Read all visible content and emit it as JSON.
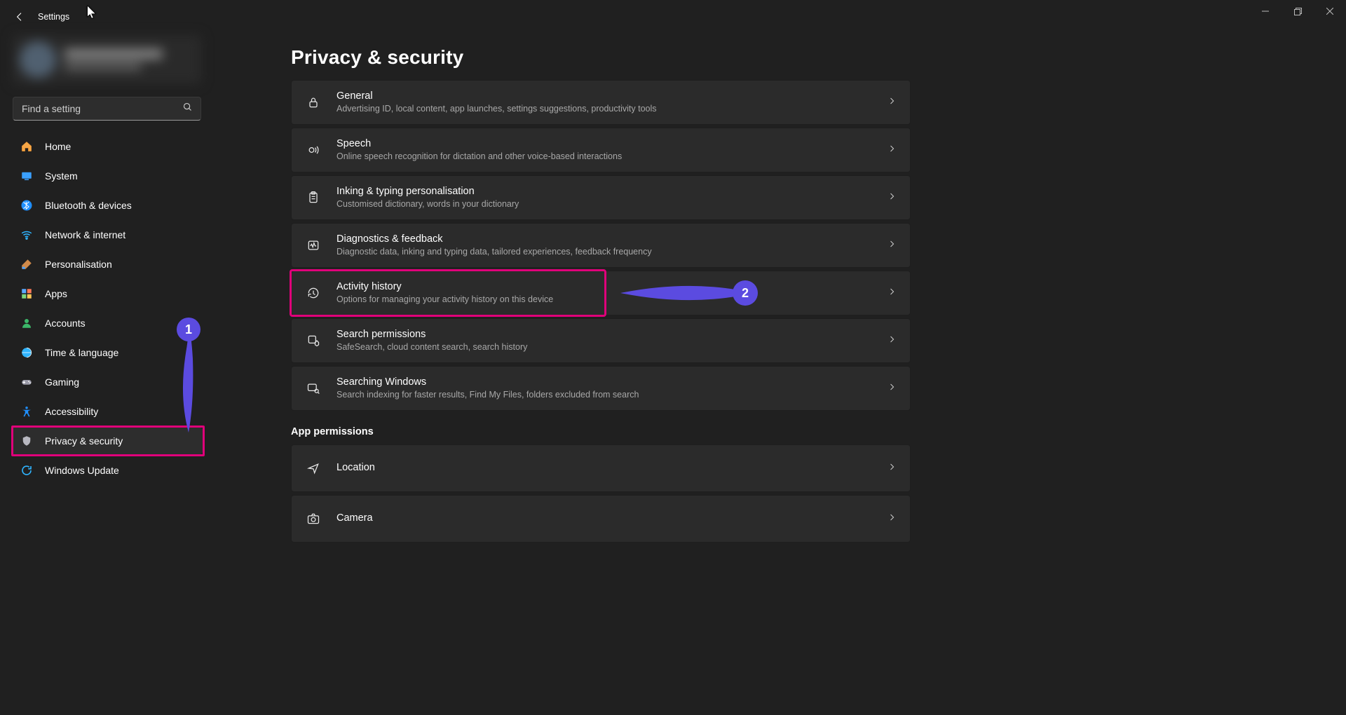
{
  "window": {
    "title": "Settings",
    "controls": {
      "minimize": "—",
      "maximize": "❐",
      "close": "✕"
    }
  },
  "search": {
    "placeholder": "Find a setting"
  },
  "sidebar": {
    "items": [
      {
        "key": "home",
        "label": "Home"
      },
      {
        "key": "system",
        "label": "System"
      },
      {
        "key": "bluetooth",
        "label": "Bluetooth & devices"
      },
      {
        "key": "network",
        "label": "Network & internet"
      },
      {
        "key": "personalisation",
        "label": "Personalisation"
      },
      {
        "key": "apps",
        "label": "Apps"
      },
      {
        "key": "accounts",
        "label": "Accounts"
      },
      {
        "key": "time",
        "label": "Time & language"
      },
      {
        "key": "gaming",
        "label": "Gaming"
      },
      {
        "key": "accessibility",
        "label": "Accessibility"
      },
      {
        "key": "privacy",
        "label": "Privacy & security",
        "selected": true
      },
      {
        "key": "update",
        "label": "Windows Update"
      }
    ]
  },
  "page": {
    "title": "Privacy & security",
    "groups": [
      {
        "header": null,
        "items": [
          {
            "key": "general",
            "title": "General",
            "desc": "Advertising ID, local content, app launches, settings suggestions, productivity tools"
          },
          {
            "key": "speech",
            "title": "Speech",
            "desc": "Online speech recognition for dictation and other voice-based interactions"
          },
          {
            "key": "inking",
            "title": "Inking & typing personalisation",
            "desc": "Customised dictionary, words in your dictionary"
          },
          {
            "key": "diag",
            "title": "Diagnostics & feedback",
            "desc": "Diagnostic data, inking and typing data, tailored experiences, feedback frequency"
          },
          {
            "key": "activity",
            "title": "Activity history",
            "desc": "Options for managing your activity history on this device"
          },
          {
            "key": "searchperm",
            "title": "Search permissions",
            "desc": "SafeSearch, cloud content search, search history"
          },
          {
            "key": "searchwin",
            "title": "Searching Windows",
            "desc": "Search indexing for faster results, Find My Files, folders excluded from search"
          }
        ]
      },
      {
        "header": "App permissions",
        "items": [
          {
            "key": "location",
            "title": "Location",
            "desc": ""
          },
          {
            "key": "camera",
            "title": "Camera",
            "desc": ""
          }
        ]
      }
    ]
  },
  "annotations": {
    "labels": {
      "one": "1",
      "two": "2"
    }
  }
}
